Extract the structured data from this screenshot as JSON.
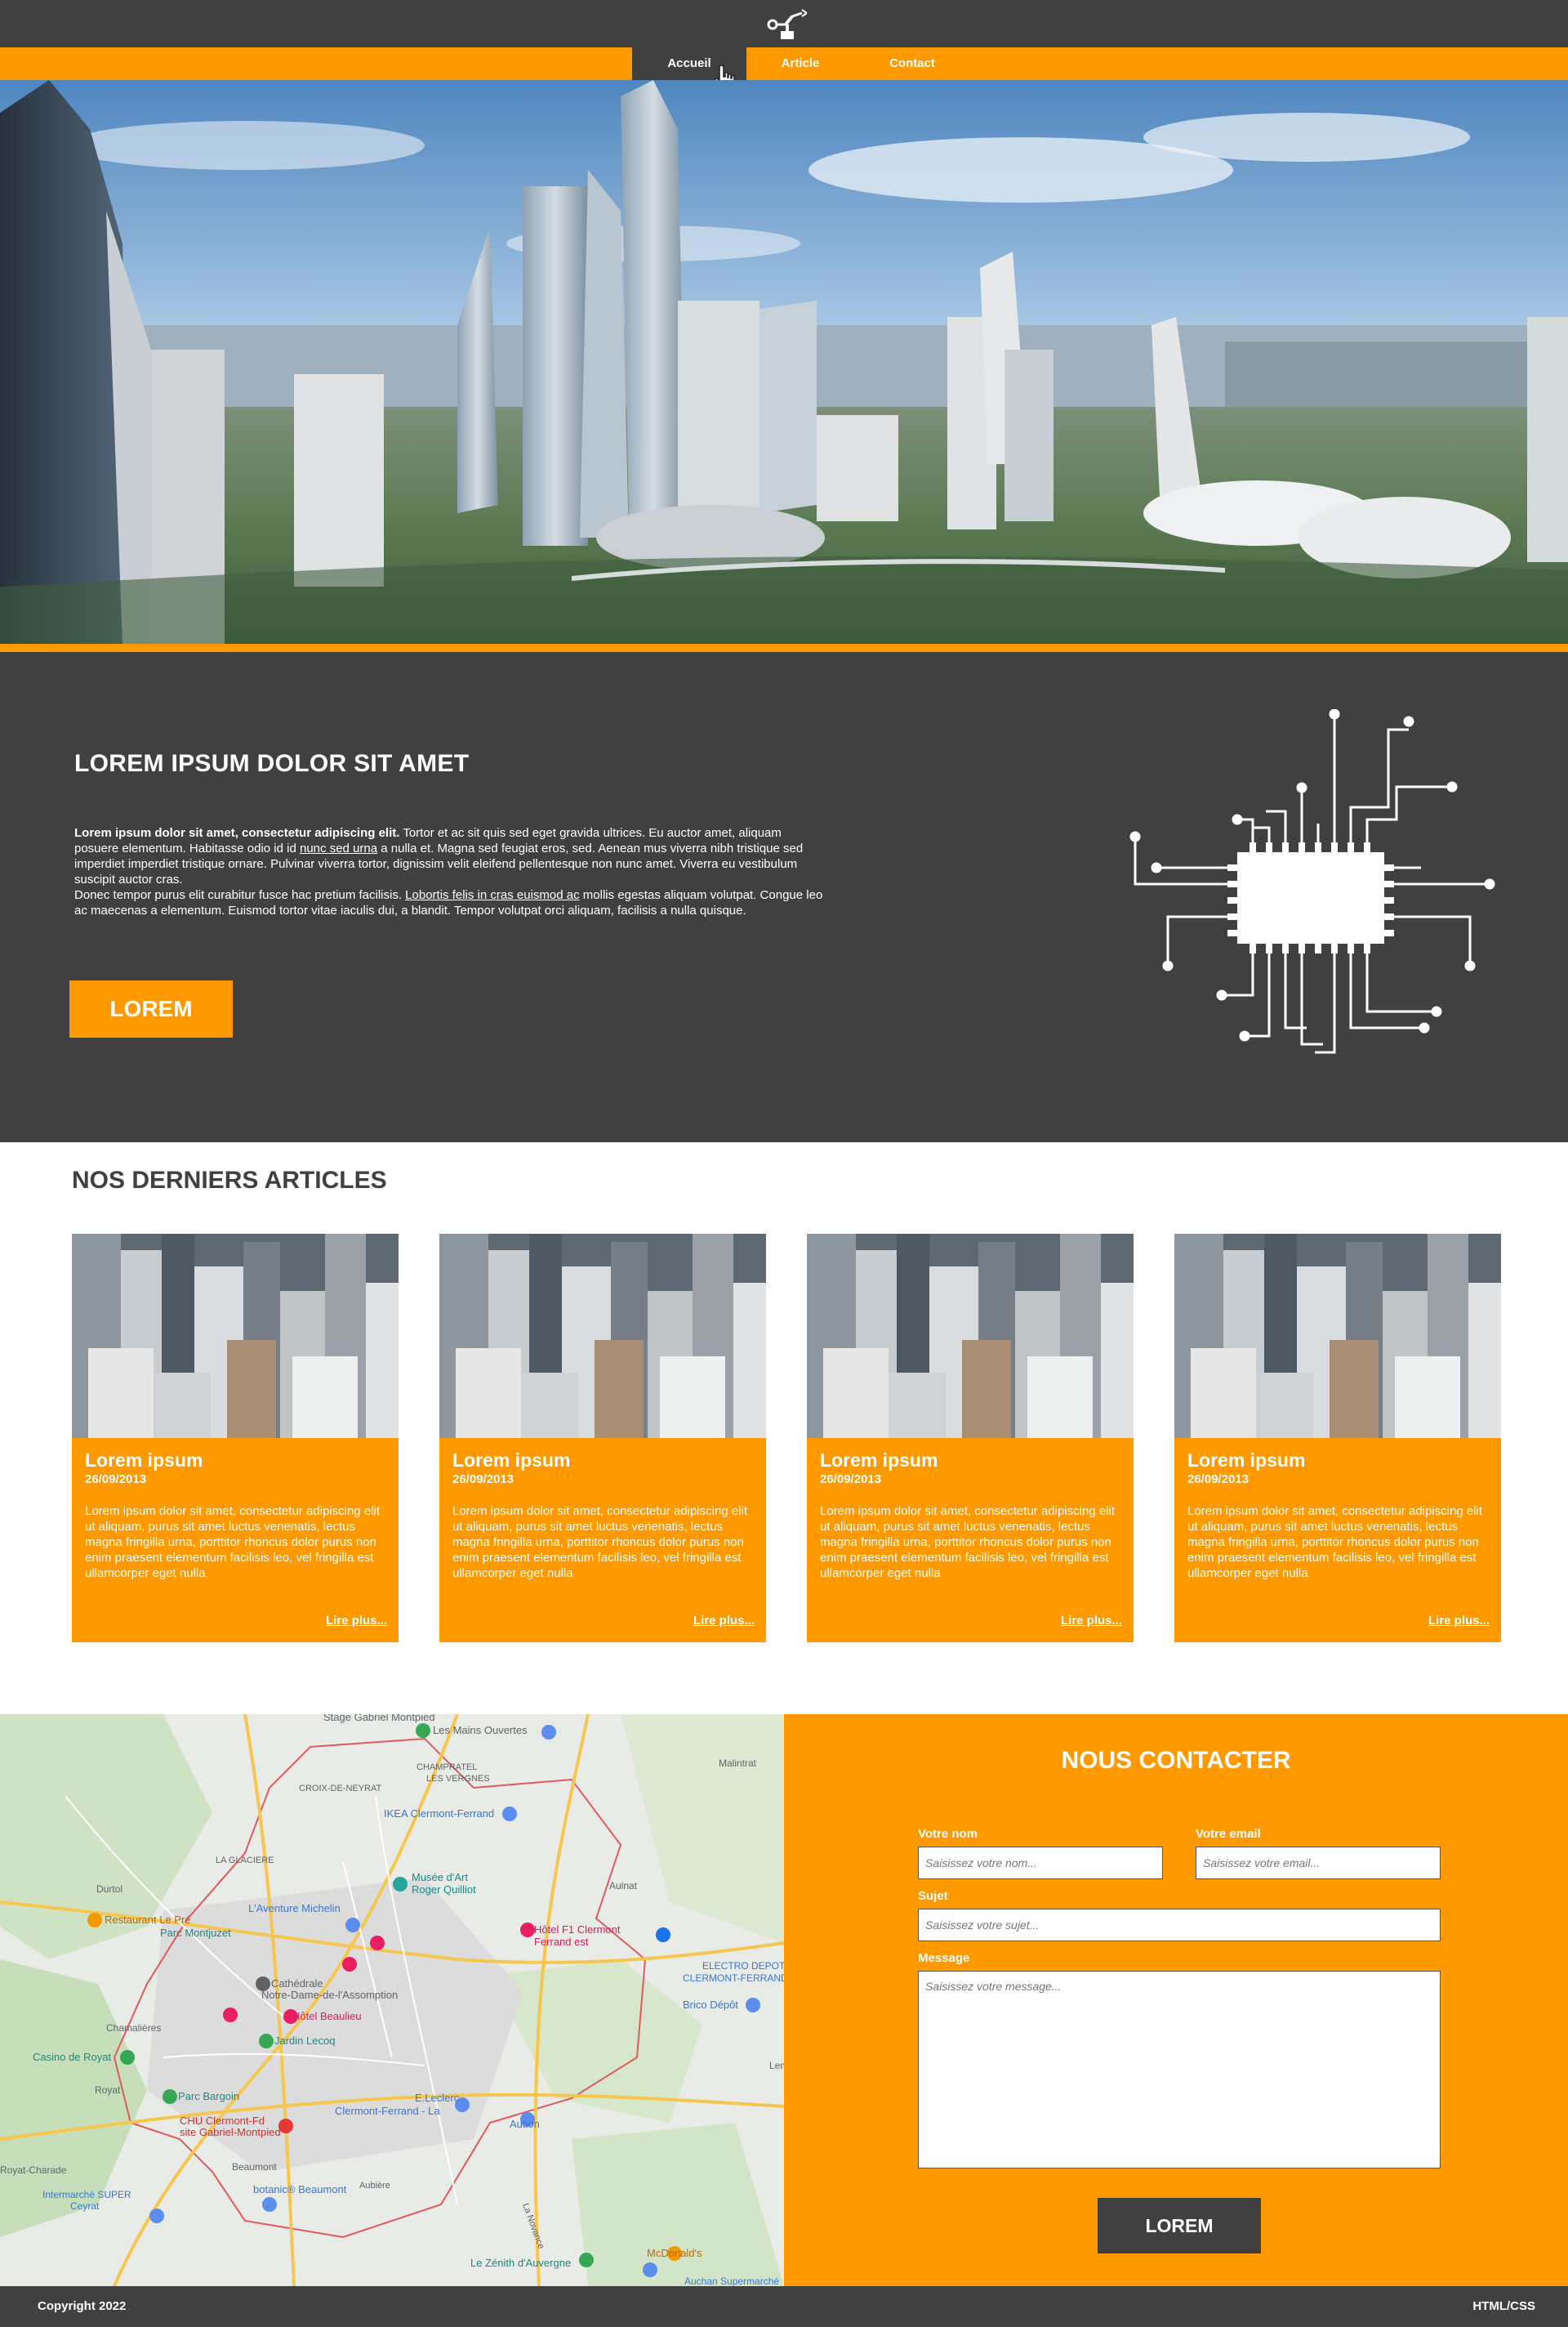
{
  "nav": {
    "items": [
      {
        "label": "Accueil",
        "active": true
      },
      {
        "label": "Article",
        "active": false
      },
      {
        "label": "Contact",
        "active": false
      }
    ]
  },
  "intro": {
    "title": "LOREM IPSUM DOLOR SIT AMET",
    "p1_bold": "Lorem ipsum dolor sit amet, consectetur adipiscing elit.",
    "p1_a": " Tortor et ac sit quis sed eget gravida ultrices. Eu auctor amet, aliquam posuere elementum. Habitasse odio id id ",
    "p1_link": "nunc sed urna",
    "p1_b": " a nulla et. Magna sed feugiat eros, sed. Aenean mus viverra nibh tristique sed imperdiet imperdiet tristique ornare. Pulvinar viverra tortor, dignissim velit eleifend pellentesque non nunc amet. Viverra eu vestibulum suscipit auctor cras.",
    "p2_a": "Donec tempor purus elit curabitur fusce hac pretium facilisis. ",
    "p2_link": "Lobortis felis in cras euismod ac",
    "p2_b": " mollis egestas aliquam volutpat. Congue leo ac maecenas a elementum. Euismod tortor vitae iaculis dui, a blandit. Tempor volutpat orci aliquam, facilisis a nulla quisque.",
    "button": "LOREM"
  },
  "articles": {
    "title": "NOS DERNIERS ARTICLES",
    "items": [
      {
        "title": "Lorem ipsum",
        "date": "26/09/2013",
        "text": "Lorem ipsum dolor sit amet, consectetur adipiscing elit ut aliquam, purus sit amet luctus venenatis, lectus magna fringilla urna, porttitor rhoncus dolor purus non enim praesent elementum facilisis leo, vel fringilla est ullamcorper eget nulla",
        "link": "Lire plus..."
      },
      {
        "title": "Lorem ipsum",
        "date": "26/09/2013",
        "text": "Lorem ipsum dolor sit amet, consectetur adipiscing elit ut aliquam, purus sit amet luctus venenatis, lectus magna fringilla urna, porttitor rhoncus dolor purus non enim praesent elementum facilisis leo, vel fringilla est ullamcorper eget nulla",
        "link": "Lire plus..."
      },
      {
        "title": "Lorem ipsum",
        "date": "26/09/2013",
        "text": "Lorem ipsum dolor sit amet, consectetur adipiscing elit ut aliquam, purus sit amet luctus venenatis, lectus magna fringilla urna, porttitor rhoncus dolor purus non enim praesent elementum facilisis leo, vel fringilla est ullamcorper eget nulla",
        "link": "Lire plus..."
      },
      {
        "title": "Lorem ipsum",
        "date": "26/09/2013",
        "text": "Lorem ipsum dolor sit amet, consectetur adipiscing elit ut aliquam, purus sit amet luctus venenatis, lectus magna fringilla urna, porttitor rhoncus dolor purus non enim praesent elementum facilisis leo, vel fringilla est ullamcorper eget nulla",
        "link": "Lire plus..."
      }
    ]
  },
  "map": {
    "labels": [
      "Stage Gabriel Montpied",
      "Les Mains Ouvertes",
      "CHAMPRATEL",
      "LES VERGNES",
      "CROIX-DE-NEYRAT",
      "IKEA Clermont-Ferrand",
      "LA GLACIERE",
      "Durtol",
      "Musée d'Art Roger Quilliot",
      "Aulnat",
      "L'Aventure Michelin",
      "Restaurant Le Pré",
      "Parc Montjuzet",
      "Hôtel F1 Clermont Ferrand est",
      "ELECTRO DEPOT CLERMONT-FERRAND",
      "Cathédrale Notre-Dame-de-l'Assomption",
      "Brico Dépôt",
      "Chamalières",
      "Hôtel Beaulieu",
      "Jardin Lecoq",
      "Casino de Royat",
      "Royat",
      "Parc Bargoin",
      "E.Leclerc Clermont-Ferrand",
      "Aubière",
      "CHU Clermont-Ferrand site Gabriel-Montpied",
      "Beaumont",
      "botanic® Beaumont",
      "Royat-Charade",
      "Intermarché SUPER Ceyrat",
      "Le Zénith d'Auvergne",
      "McDonald's",
      "Auchan Supermarché",
      "Malintrat",
      "Lempdes",
      "La Novance"
    ]
  },
  "contact": {
    "title": "NOUS CONTACTER",
    "name_label": "Votre nom",
    "name_placeholder": "Saisissez votre nom...",
    "email_label": "Votre email",
    "email_placeholder": "Saisissez votre email...",
    "subject_label": "Sujet",
    "subject_placeholder": "Saisissez votre sujet...",
    "message_label": "Message",
    "message_placeholder": "Saisissez votre message...",
    "button": "LOREM"
  },
  "footer": {
    "copyright": "Copyright 2022",
    "tech": "HTML/CSS"
  },
  "colors": {
    "accent": "#ff9900",
    "dark": "#404040",
    "white": "#ffffff"
  },
  "icons": [
    "robot-arm-logo-icon",
    "hand-cursor-icon",
    "circuit-chip-icon",
    "map-pin-icon"
  ]
}
